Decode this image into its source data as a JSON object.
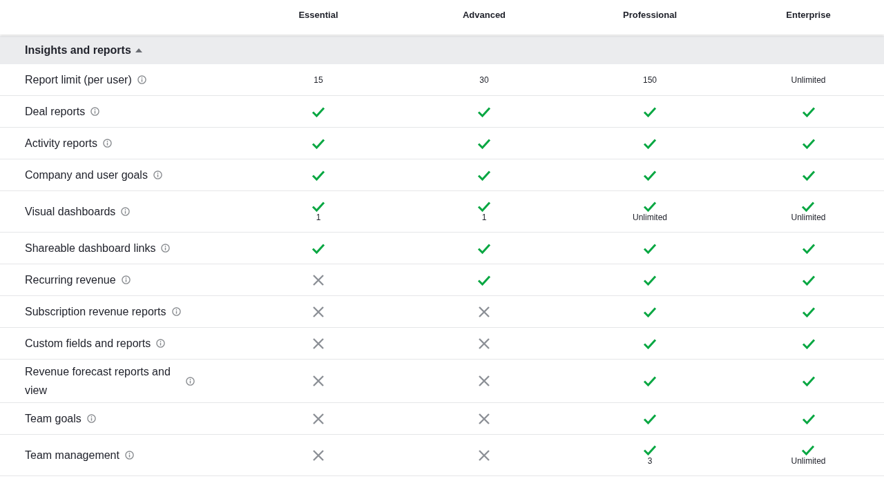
{
  "plans": [
    "Essential",
    "Advanced",
    "Professional",
    "Enterprise"
  ],
  "section": {
    "title": "Insights and reports",
    "expanded": true
  },
  "rows": [
    {
      "label": "Report limit (per user)",
      "cells": [
        {
          "kind": "text",
          "text": "15"
        },
        {
          "kind": "text",
          "text": "30"
        },
        {
          "kind": "text",
          "text": "150"
        },
        {
          "kind": "text",
          "text": "Unlimited"
        }
      ]
    },
    {
      "label": "Deal reports",
      "cells": [
        {
          "kind": "check"
        },
        {
          "kind": "check"
        },
        {
          "kind": "check"
        },
        {
          "kind": "check"
        }
      ]
    },
    {
      "label": "Activity reports",
      "cells": [
        {
          "kind": "check"
        },
        {
          "kind": "check"
        },
        {
          "kind": "check"
        },
        {
          "kind": "check"
        }
      ]
    },
    {
      "label": "Company and user goals",
      "cells": [
        {
          "kind": "check"
        },
        {
          "kind": "check"
        },
        {
          "kind": "check"
        },
        {
          "kind": "check"
        }
      ]
    },
    {
      "label": "Visual dashboards",
      "cells": [
        {
          "kind": "check",
          "note": "1"
        },
        {
          "kind": "check",
          "note": "1"
        },
        {
          "kind": "check",
          "note": "Unlimited"
        },
        {
          "kind": "check",
          "note": "Unlimited"
        }
      ]
    },
    {
      "label": "Shareable dashboard links",
      "cells": [
        {
          "kind": "check"
        },
        {
          "kind": "check"
        },
        {
          "kind": "check"
        },
        {
          "kind": "check"
        }
      ]
    },
    {
      "label": "Recurring revenue",
      "cells": [
        {
          "kind": "cross"
        },
        {
          "kind": "check"
        },
        {
          "kind": "check"
        },
        {
          "kind": "check"
        }
      ]
    },
    {
      "label": "Subscription revenue reports",
      "cells": [
        {
          "kind": "cross"
        },
        {
          "kind": "cross"
        },
        {
          "kind": "check"
        },
        {
          "kind": "check"
        }
      ]
    },
    {
      "label": "Custom fields and reports",
      "cells": [
        {
          "kind": "cross"
        },
        {
          "kind": "cross"
        },
        {
          "kind": "check"
        },
        {
          "kind": "check"
        }
      ]
    },
    {
      "label": "Revenue forecast reports and view",
      "cells": [
        {
          "kind": "cross"
        },
        {
          "kind": "cross"
        },
        {
          "kind": "check"
        },
        {
          "kind": "check"
        }
      ]
    },
    {
      "label": "Team goals",
      "cells": [
        {
          "kind": "cross"
        },
        {
          "kind": "cross"
        },
        {
          "kind": "check"
        },
        {
          "kind": "check"
        }
      ]
    },
    {
      "label": "Team management",
      "cells": [
        {
          "kind": "cross"
        },
        {
          "kind": "cross"
        },
        {
          "kind": "check",
          "note": "3"
        },
        {
          "kind": "check",
          "note": "Unlimited"
        }
      ]
    }
  ]
}
